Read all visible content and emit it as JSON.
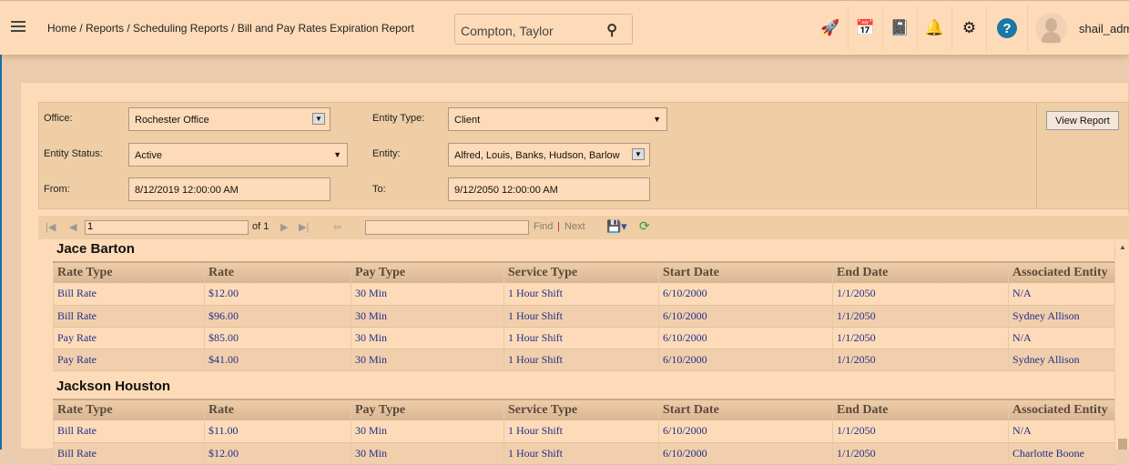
{
  "header": {
    "breadcrumb": "Home / Reports / Scheduling Reports / Bill and Pay Rates Expiration Report",
    "search_value": "Compton, Taylor",
    "user": "shail_adm"
  },
  "params": {
    "office_label": "Office:",
    "office": "Rochester Office",
    "entity_type_label": "Entity Type:",
    "entity_type": "Client",
    "entity_status_label": "Entity Status:",
    "entity_status": "Active",
    "entity_label": "Entity:",
    "entity": "Alfred, Louis, Banks, Hudson, Barlow",
    "from_label": "From:",
    "from": "8/12/2019 12:00:00 AM",
    "to_label": "To:",
    "to": "9/12/2050 12:00:00 AM",
    "view_report": "View Report"
  },
  "toolbar": {
    "page": "1",
    "of": "of 1",
    "find": "Find",
    "next": "Next"
  },
  "columns": [
    "Rate Type",
    "Rate",
    "Pay Type",
    "Service Type",
    "Start Date",
    "End Date",
    "Associated Entity"
  ],
  "groups": [
    {
      "name": "Jace Barton",
      "rows": [
        [
          "Bill Rate",
          "$12.00",
          "30 Min",
          "1 Hour Shift",
          "6/10/2000",
          "1/1/2050",
          "N/A"
        ],
        [
          "Bill Rate",
          "$96.00",
          "30 Min",
          "1 Hour Shift",
          "6/10/2000",
          "1/1/2050",
          "Sydney Allison"
        ],
        [
          "Pay Rate",
          "$85.00",
          "30 Min",
          "1 Hour Shift",
          "6/10/2000",
          "1/1/2050",
          "N/A"
        ],
        [
          "Pay Rate",
          "$41.00",
          "30 Min",
          "1 Hour Shift",
          "6/10/2000",
          "1/1/2050",
          "Sydney Allison"
        ]
      ]
    },
    {
      "name": "Jackson Houston",
      "rows": [
        [
          "Bill Rate",
          "$11.00",
          "30 Min",
          "1 Hour Shift",
          "6/10/2000",
          "1/1/2050",
          "N/A"
        ],
        [
          "Bill Rate",
          "$12.00",
          "30 Min",
          "1 Hour Shift",
          "6/10/2000",
          "1/1/2050",
          "Charlotte Boone"
        ]
      ]
    }
  ]
}
